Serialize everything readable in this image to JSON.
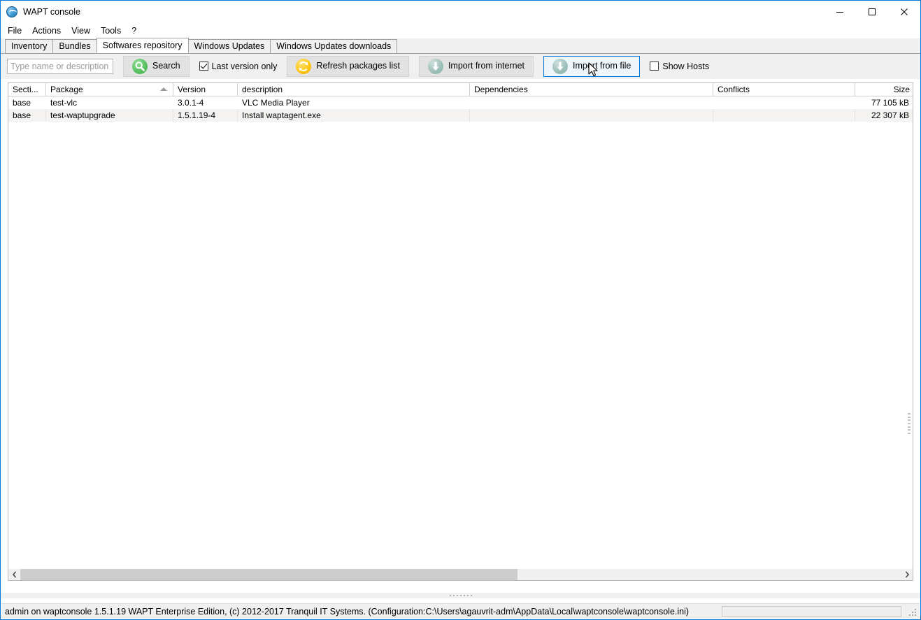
{
  "window": {
    "title": "WAPT console",
    "icon": "wapt-globe-icon",
    "accent_color": "#0078d7",
    "controls": {
      "minimize": "minimize-icon",
      "maximize": "maximize-icon",
      "close": "close-icon"
    }
  },
  "menubar": {
    "items": [
      {
        "label": "File"
      },
      {
        "label": "Actions"
      },
      {
        "label": "View"
      },
      {
        "label": "Tools"
      },
      {
        "label": "?"
      }
    ]
  },
  "tabs": {
    "active": "Softwares repository",
    "items": [
      {
        "label": "Inventory"
      },
      {
        "label": "Bundles"
      },
      {
        "label": "Softwares repository"
      },
      {
        "label": "Windows Updates"
      },
      {
        "label": "Windows Updates downloads"
      }
    ]
  },
  "toolbar": {
    "search_placeholder": "Type name or description",
    "search_value": "",
    "search_button": "Search",
    "search_icon": "magnifier-icon",
    "last_version_only_label": "Last version only",
    "last_version_only_checked": true,
    "refresh_button": "Refresh packages list",
    "refresh_icon": "refresh-circular-arrows-icon",
    "import_internet_button": "Import from internet",
    "import_internet_icon": "download-arrow-icon",
    "import_file_button": "Import from file",
    "import_file_icon": "download-arrow-icon",
    "import_file_state": "hover",
    "show_hosts_label": "Show Hosts",
    "show_hosts_checked": false
  },
  "grid": {
    "sort_column": "Package",
    "sort_direction": "ascending",
    "columns": [
      {
        "key": "section",
        "label": "Secti...",
        "align": "left"
      },
      {
        "key": "package",
        "label": "Package",
        "align": "left"
      },
      {
        "key": "version",
        "label": "Version",
        "align": "left"
      },
      {
        "key": "description",
        "label": "description",
        "align": "left"
      },
      {
        "key": "dependencies",
        "label": "Dependencies",
        "align": "left"
      },
      {
        "key": "conflicts",
        "label": "Conflicts",
        "align": "left"
      },
      {
        "key": "size",
        "label": "Size",
        "align": "right"
      }
    ],
    "rows": [
      {
        "section": "base",
        "package": "test-vlc",
        "version": "3.0.1-4",
        "description": "VLC Media Player",
        "dependencies": "",
        "conflicts": "",
        "size": "77 105 kB"
      },
      {
        "section": "base",
        "package": "test-waptupgrade",
        "version": "1.5.1.19-4",
        "description": "Install waptagent.exe",
        "dependencies": "",
        "conflicts": "",
        "size": "22 307 kB"
      }
    ]
  },
  "statusbar": {
    "text": "admin on waptconsole 1.5.1.19 WAPT Enterprise Edition, (c) 2012-2017 Tranquil IT Systems. (Configuration:C:\\Users\\agauvrit-adm\\AppData\\Local\\waptconsole\\waptconsole.ini)",
    "right_panel_text": ""
  }
}
